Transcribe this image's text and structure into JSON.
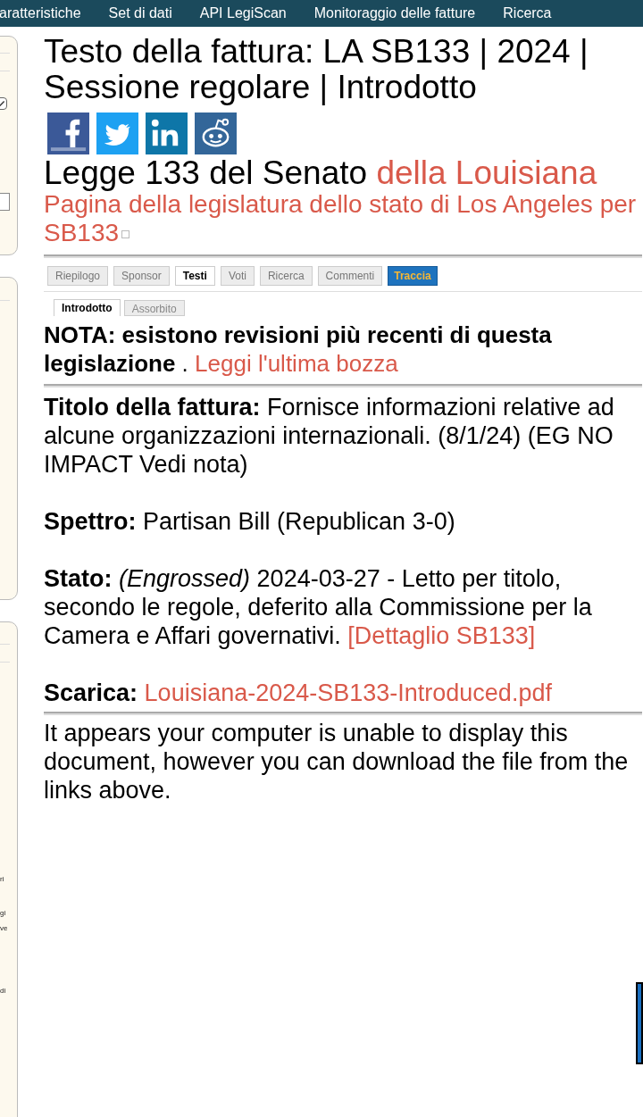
{
  "nav": [
    "aratteristiche",
    "Set di dati",
    "API LegiScan",
    "Monitoraggio delle fatture",
    "Ricerca"
  ],
  "sidebar": {
    "checkbox_checked": true,
    "fragments": [
      "ri",
      "gi",
      "ve",
      "di"
    ]
  },
  "title": "Testo della fattura: LA SB133 | 2024 | Sessione regolare | Introdotto",
  "bill_name": {
    "text": "Legge 133 del Senato",
    "link": "della Louisiana"
  },
  "legislature_link": "Pagina della legislatura dello stato di Los Angeles per SB133",
  "tabs": [
    {
      "label": "Riepilogo",
      "kind": "tab",
      "selected": false
    },
    {
      "label": "Sponsor",
      "kind": "tab",
      "selected": false
    },
    {
      "label": "Testi",
      "kind": "tab",
      "selected": true
    },
    {
      "label": "Voti",
      "kind": "tab",
      "selected": false
    },
    {
      "label": "Ricerca",
      "kind": "tab",
      "selected": false
    },
    {
      "label": "Commenti",
      "kind": "tab",
      "selected": false
    },
    {
      "label": "Traccia",
      "kind": "action",
      "selected": false
    }
  ],
  "subtabs": [
    {
      "label": "Introdotto",
      "selected": true
    },
    {
      "label": "Assorbito",
      "selected": false
    }
  ],
  "note": {
    "text": "NOTA: esistono revisioni più recenti di questa legislazione",
    "punct": ".",
    "link": "Leggi l'ultima bozza"
  },
  "fields": [
    {
      "label": "Titolo della fattura:",
      "value": "Fornisce informazioni relative ad alcune organizzazioni internazionali. (8/1/24) (EG NO IMPACT Vedi nota)"
    },
    {
      "label": "Spettro:",
      "value": "Partisan Bill (Republican 3-0)"
    },
    {
      "label": "Stato:",
      "italic": "(Engrossed)",
      "value": "2024-03-27 - Letto per titolo, secondo le regole, deferito alla Commissione per la Camera e Affari governativi.",
      "link": "[Dettaglio SB133]"
    },
    {
      "label": "Scarica:",
      "link": "Louisiana-2024-SB133-Introduced.pdf"
    }
  ],
  "message": "It appears your computer is unable to display this document, however you can download the file from the links above."
}
